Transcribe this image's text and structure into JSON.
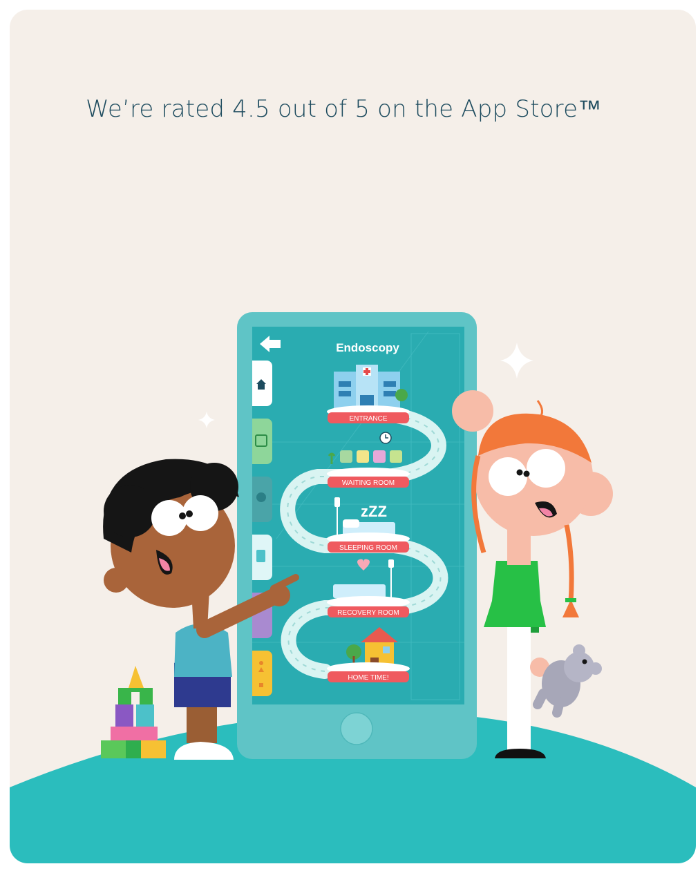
{
  "headline": "We’re rated 4.5 out of 5 on the App Store™",
  "rating": {
    "value": 4.5,
    "max": 5
  },
  "app_screen": {
    "title": "Endoscopy",
    "stops": [
      "ENTRANCE",
      "WAITING ROOM",
      "SLEEPING ROOM",
      "RECOVERY ROOM",
      "HOME TIME!"
    ],
    "side_tabs": [
      "home-icon",
      "calendar-star-icon",
      "map-pin-icon",
      "document-icon",
      "picture-icon",
      "shapes-icon"
    ]
  },
  "colors": {
    "background": "#f5efe9",
    "ground": "#2bbdbd",
    "phone_frame": "#5fc4c6",
    "phone_screen": "#2aacb1",
    "label_ribbon": "#ef5a5f",
    "headline_text": "#1d4b5e"
  }
}
